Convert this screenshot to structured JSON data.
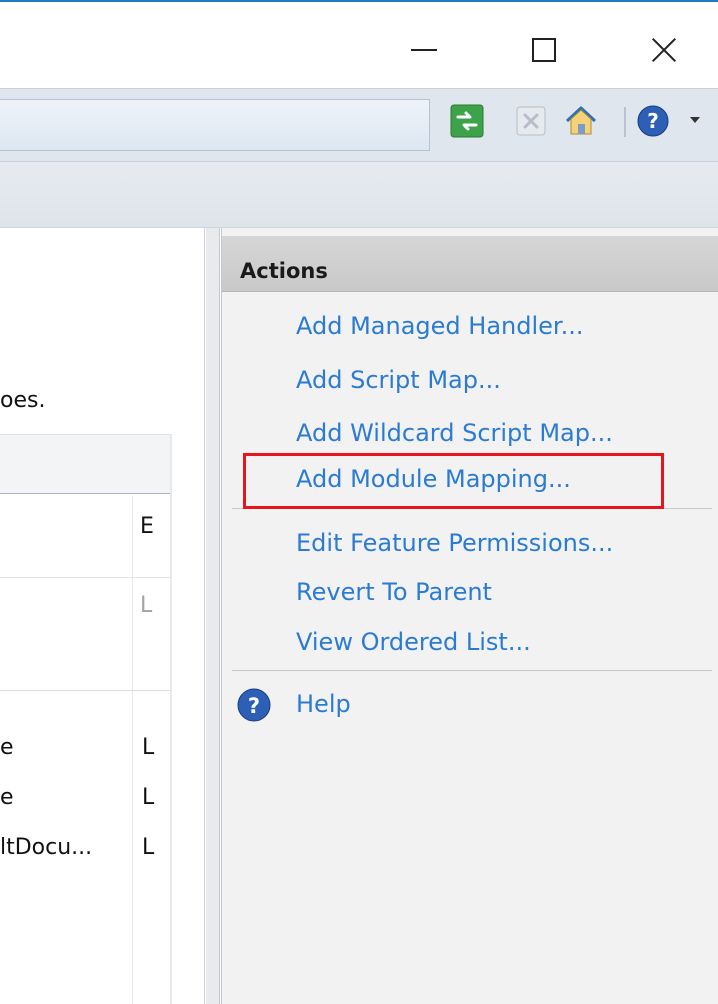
{
  "window": {
    "controls": {
      "minimize": "—",
      "maximize": "☐",
      "close": "✕"
    }
  },
  "toolbar": {
    "icons": [
      "go-icon",
      "stop-icon",
      "home-icon",
      "help-icon",
      "dropdown-caret-icon"
    ]
  },
  "left": {
    "description_fragment": "oes.",
    "column_header_fragment": "E",
    "group_fragment": "L",
    "rows": [
      {
        "name_fragment": "e",
        "type_fragment": "L"
      },
      {
        "name_fragment": "e",
        "type_fragment": "L"
      },
      {
        "name_fragment": "ltDocu...",
        "type_fragment": "L"
      }
    ]
  },
  "actions": {
    "title": "Actions",
    "group1": [
      "Add Managed Handler...",
      "Add Script Map...",
      "Add Wildcard Script Map...",
      "Add Module Mapping..."
    ],
    "group2": [
      "Edit Feature Permissions...",
      "Revert To Parent",
      "View Ordered List..."
    ],
    "help": "Help"
  },
  "colors": {
    "link": "#2b7bd3",
    "highlight": "#e8141c",
    "title_accent": "#1e7bc4"
  }
}
